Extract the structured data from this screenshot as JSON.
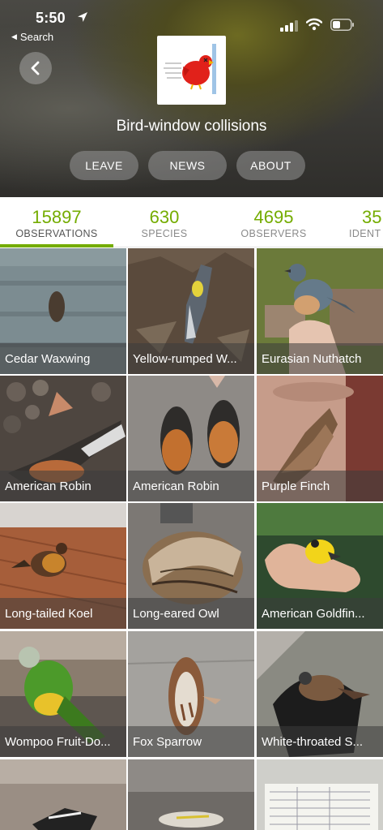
{
  "status_bar": {
    "time": "5:50",
    "back_to_app": "Search",
    "icons": [
      "location-arrow-icon",
      "signal-icon",
      "wifi-icon",
      "battery-icon"
    ]
  },
  "header": {
    "back_icon": "chevron-left-icon",
    "title": "Bird-window collisions",
    "buttons": {
      "leave": "LEAVE",
      "news": "NEWS",
      "about": "ABOUT"
    }
  },
  "stats": [
    {
      "value": "15897",
      "label": "OBSERVATIONS",
      "active": true
    },
    {
      "value": "630",
      "label": "SPECIES",
      "active": false
    },
    {
      "value": "4695",
      "label": "OBSERVERS",
      "active": false
    },
    {
      "value": "35",
      "label": "IDENT",
      "active": false
    }
  ],
  "observations": [
    {
      "name": "Cedar Waxwing"
    },
    {
      "name": "Yellow-rumped W..."
    },
    {
      "name": "Eurasian Nuthatch"
    },
    {
      "name": "American Robin"
    },
    {
      "name": "American Robin"
    },
    {
      "name": "Purple Finch"
    },
    {
      "name": "Long-tailed Koel"
    },
    {
      "name": "Long-eared Owl"
    },
    {
      "name": "American Goldfin..."
    },
    {
      "name": "Wompoo Fruit-Do..."
    },
    {
      "name": "Fox Sparrow"
    },
    {
      "name": "White-throated S..."
    }
  ],
  "colors": {
    "accent": "#74ac00",
    "label_overlay": "#3c3c3c"
  }
}
